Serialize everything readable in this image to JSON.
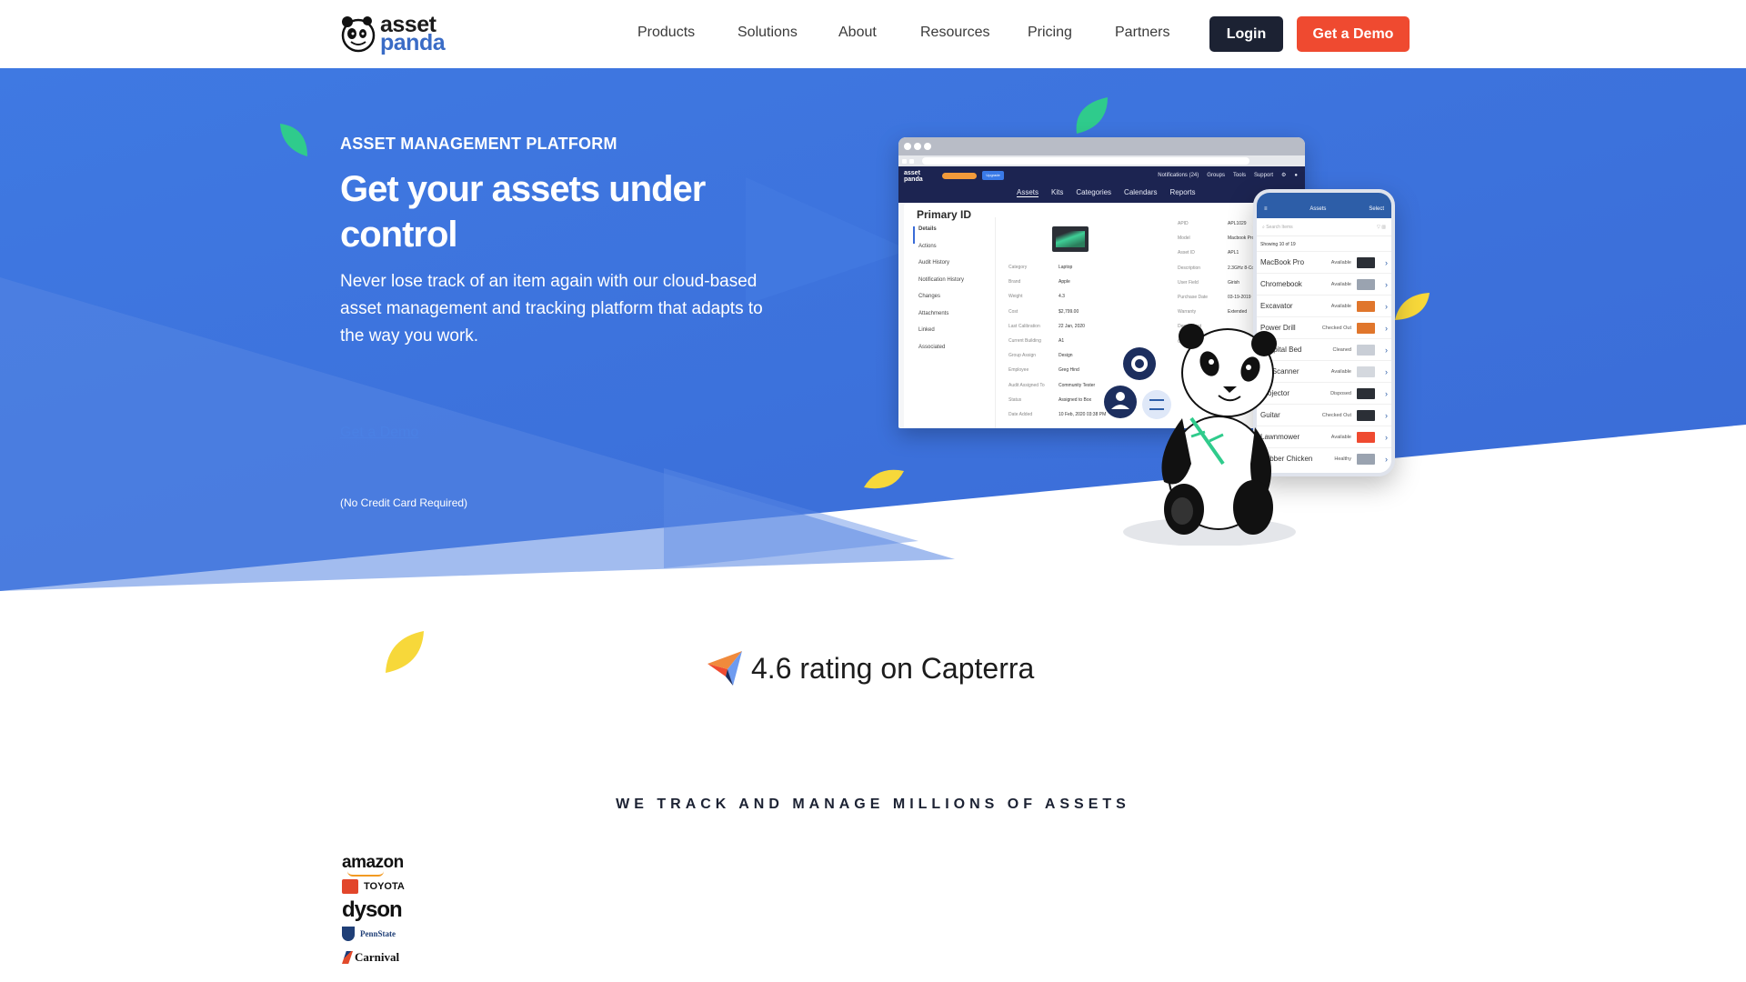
{
  "header": {
    "logo": {
      "line1": "asset",
      "line2": "panda"
    },
    "nav": [
      {
        "label": "Products"
      },
      {
        "label": "Solutions"
      },
      {
        "label": "About"
      },
      {
        "label": "Resources"
      },
      {
        "label": "Pricing"
      },
      {
        "label": "Partners"
      }
    ],
    "login_label": "Login",
    "demo_label": "Get a Demo"
  },
  "hero": {
    "eyebrow": "ASSET MANAGEMENT PLATFORM",
    "title": "Get your assets under control",
    "description": "Never lose track of an item again with our cloud-based asset management and tracking platform that adapts to the way you work.",
    "cta_link": "Get a Demo",
    "note": "(No Credit Card Required)"
  },
  "desktop_mockup": {
    "logo": {
      "line1": "asset",
      "line2": "panda"
    },
    "upgrade_label": "Upgrade",
    "top_links": [
      "Notifications (24)",
      "Groups",
      "Tools",
      "Support"
    ],
    "tabs": [
      "Assets",
      "Kits",
      "Categories",
      "Calendars",
      "Reports"
    ],
    "active_tab": "Assets",
    "record_title": "Primary ID",
    "side_menu": [
      "Details",
      "Actions",
      "Audit History",
      "Notification History",
      "Changes",
      "Attachments",
      "Linked",
      "Associated"
    ],
    "left_fields": [
      {
        "key": "Category",
        "value": "Laptop"
      },
      {
        "key": "Brand",
        "value": "Apple"
      },
      {
        "key": "Weight",
        "value": "4.3"
      },
      {
        "key": "Cost",
        "value": "$2,799.00"
      },
      {
        "key": "Last Calibration",
        "value": "22 Jan, 2020"
      },
      {
        "key": "Current Building",
        "value": "A1"
      },
      {
        "key": "Group Assign",
        "value": "Design"
      },
      {
        "key": "Employee",
        "value": "Greg Hind"
      },
      {
        "key": "Audit Assigned To",
        "value": "Community Tester"
      },
      {
        "key": "Status",
        "value": "Assigned to Box"
      },
      {
        "key": "Date Added",
        "value": "10 Feb, 2020 03:38 PM"
      }
    ],
    "right_fields": [
      {
        "key": "APID",
        "value": "APL1029"
      },
      {
        "key": "Model",
        "value": "Macbook Pro"
      },
      {
        "key": "Asset ID",
        "value": "APL1"
      },
      {
        "key": "Description",
        "value": "2.3GHz 8-Core"
      },
      {
        "key": "User Field",
        "value": "Girish"
      },
      {
        "key": "Purchase Date",
        "value": "03-19-2019"
      },
      {
        "key": "Warranty",
        "value": "Extended"
      },
      {
        "key": "Department",
        "value": ""
      },
      {
        "key": "Current Ro",
        "value": ""
      }
    ]
  },
  "phone_mockup": {
    "title": "Assets",
    "select_label": "Select",
    "search_placeholder": "Search Items",
    "count_text": "Showing 10 of 19",
    "items": [
      {
        "name": "MacBook Pro",
        "status": "Available"
      },
      {
        "name": "Chromebook",
        "status": "Available"
      },
      {
        "name": "Excavator",
        "status": "Available"
      },
      {
        "name": "Power Drill",
        "status": "Checked Out"
      },
      {
        "name": "Hospital Bed",
        "status": "Cleaned"
      },
      {
        "name": "CT Scanner",
        "status": "Available"
      },
      {
        "name": "Projector",
        "status": "Disposed"
      },
      {
        "name": "Guitar",
        "status": "Checked Out"
      },
      {
        "name": "Lawnmower",
        "status": "Available"
      },
      {
        "name": "Rubber Chicken",
        "status": "Healthy"
      }
    ]
  },
  "rating": {
    "text": "4.6 rating on Capterra",
    "icon": "capterra-logo"
  },
  "customers": {
    "heading": "WE TRACK AND MANAGE MILLIONS OF ASSETS",
    "logos": [
      "amazon",
      "TOYOTA",
      "dyson",
      "PennState",
      "Carnival"
    ]
  },
  "colors": {
    "hero_blue": "#3f78e0",
    "brand_blue": "#3a6cc6",
    "demo_red": "#ef4a30",
    "login_dark": "#1c2233",
    "leaf_green": "#2fcb8c",
    "leaf_yellow": "#f7d83a"
  }
}
